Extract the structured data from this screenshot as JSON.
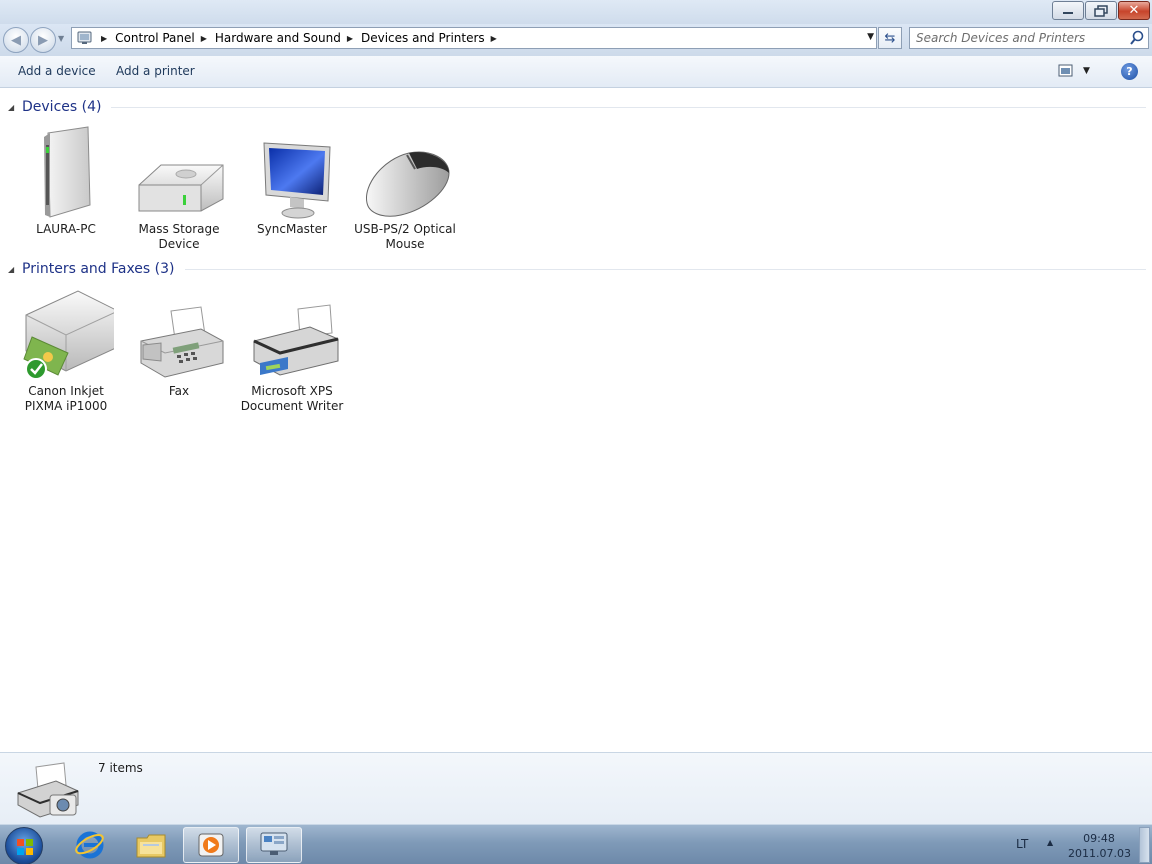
{
  "window": {
    "buttons": {
      "minimize_icon": "minimize-icon",
      "maximize_icon": "restore-icon",
      "close_icon": "close-icon"
    }
  },
  "nav": {
    "breadcrumbs": [
      "Control Panel",
      "Hardware and Sound",
      "Devices and Printers"
    ],
    "search_placeholder": "Search Devices and Printers"
  },
  "commands": {
    "add_device": "Add a device",
    "add_printer": "Add a printer"
  },
  "groups": {
    "devices": {
      "title": "Devices (4)",
      "items": [
        {
          "label": "LAURA-PC",
          "icon": "computer-tower-icon"
        },
        {
          "label": "Mass Storage Device",
          "icon": "external-drive-icon"
        },
        {
          "label": "SyncMaster",
          "icon": "monitor-icon"
        },
        {
          "label": "USB-PS/2 Optical Mouse",
          "icon": "mouse-icon"
        }
      ]
    },
    "printers": {
      "title": "Printers and Faxes (3)",
      "items": [
        {
          "label": "Canon Inkjet PIXMA iP1000",
          "icon": "printer-icon",
          "default": true
        },
        {
          "label": "Fax",
          "icon": "fax-icon"
        },
        {
          "label": "Microsoft XPS Document Writer",
          "icon": "printer-icon"
        }
      ]
    }
  },
  "details": {
    "count": "7 items"
  },
  "taskbar": {
    "language": "LT",
    "time": "09:48",
    "date": "2011.07.03"
  },
  "colors": {
    "group_title": "#1e3287",
    "command_text": "#1e395b",
    "default_check": "#2e9a2e"
  }
}
